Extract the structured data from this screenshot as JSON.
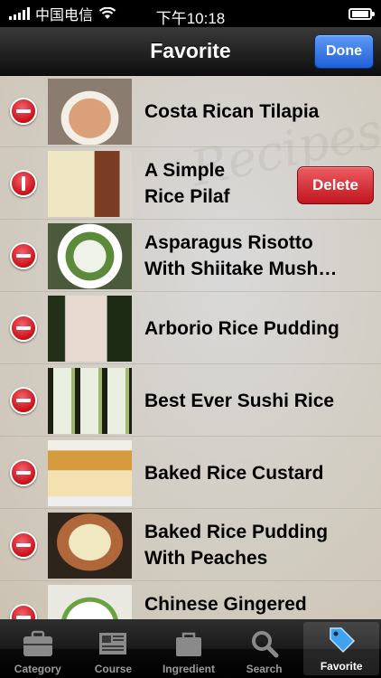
{
  "status_bar": {
    "carrier": "中国电信",
    "time": "下午10:18"
  },
  "nav": {
    "title": "Favorite",
    "done_label": "Done"
  },
  "rows": [
    {
      "title": "Costa Rican Tilapia",
      "mode": "delete-indicator"
    },
    {
      "title": "A Simple\nRice Pilaf",
      "mode": "confirm-delete",
      "delete_label": "Delete"
    },
    {
      "title": "Asparagus Risotto\nWith Shiitake Mush…",
      "mode": "delete-indicator"
    },
    {
      "title": "Arborio Rice Pudding",
      "mode": "delete-indicator"
    },
    {
      "title": "Best Ever Sushi Rice",
      "mode": "delete-indicator"
    },
    {
      "title": "Baked Rice Custard",
      "mode": "delete-indicator"
    },
    {
      "title": "Baked Rice Pudding\nWith Peaches",
      "mode": "delete-indicator"
    },
    {
      "title": "Chinese Gingered\nRi",
      "mode": "delete-indicator"
    }
  ],
  "tabs": [
    {
      "label": "Category",
      "icon": "briefcase-icon",
      "active": false
    },
    {
      "label": "Course",
      "icon": "newspaper-icon",
      "active": false
    },
    {
      "label": "Ingredient",
      "icon": "bag-icon",
      "active": false
    },
    {
      "label": "Search",
      "icon": "search-icon",
      "active": false
    },
    {
      "label": "Favorite",
      "icon": "tag-icon",
      "active": true
    }
  ],
  "colors": {
    "accent": "#2a6be0",
    "delete": "#d3141e"
  }
}
